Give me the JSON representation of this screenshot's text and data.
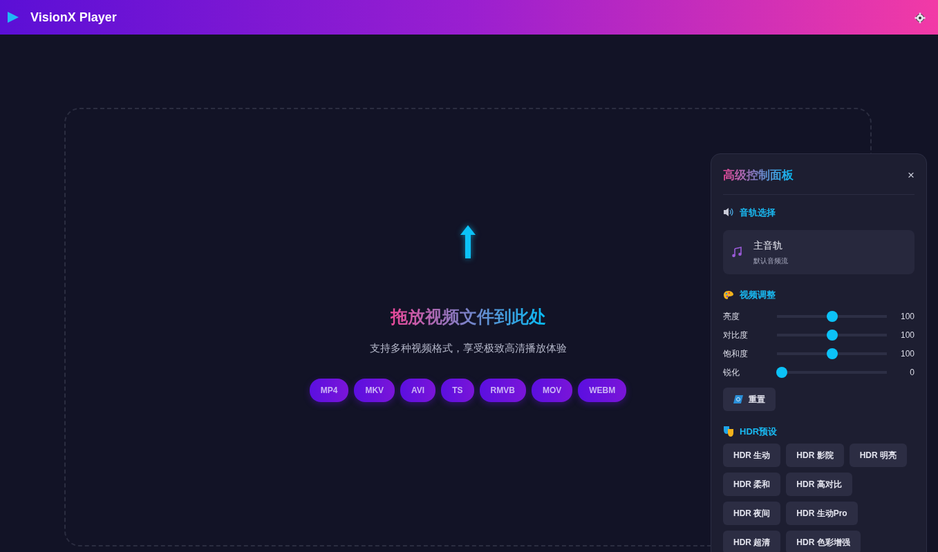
{
  "app": {
    "title": "VisionX Player"
  },
  "drop_zone": {
    "title": "拖放视频文件到此处",
    "subtitle": "支持多种视频格式，享受极致高清播放体验",
    "formats": [
      "MP4",
      "MKV",
      "AVI",
      "TS",
      "RMVB",
      "MOV",
      "WEBM"
    ]
  },
  "panel": {
    "title": "高级控制面板",
    "close": "×",
    "audio": {
      "heading": "音轨选择",
      "tracks": [
        {
          "name": "主音轨",
          "description": "默认音频流"
        }
      ]
    },
    "video": {
      "heading": "视频调整",
      "sliders": [
        {
          "label": "亮度",
          "level": 0.5,
          "reading": "100"
        },
        {
          "label": "对比度",
          "level": 0.5,
          "reading": "100"
        },
        {
          "label": "饱和度",
          "level": 0.5,
          "reading": "100"
        },
        {
          "label": "锐化",
          "level": 0,
          "reading": "0"
        }
      ],
      "reset": "重置"
    },
    "hdr": {
      "heading": "HDR预设",
      "presets": [
        "HDR 生动",
        "HDR 影院",
        "HDR 明亮",
        "HDR 柔和",
        "HDR 高对比",
        "HDR 夜间",
        "HDR 生动Pro",
        "HDR 超清",
        "HDR 色彩增强"
      ]
    }
  }
}
